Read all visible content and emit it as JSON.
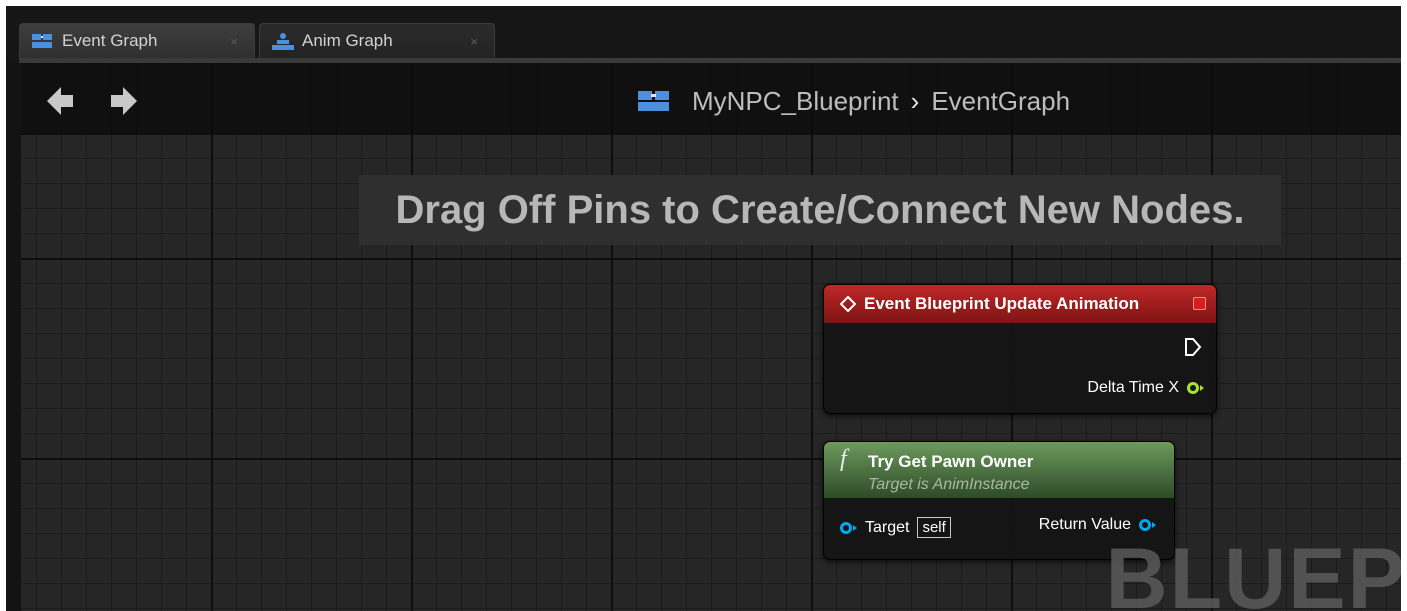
{
  "tabs": [
    {
      "label": "Event Graph",
      "close": "×",
      "icon": "event-graph-icon",
      "active": true
    },
    {
      "label": "Anim Graph",
      "close": "×",
      "icon": "anim-graph-icon",
      "active": false
    }
  ],
  "navigation": {
    "back_icon": "back-arrow-icon",
    "forward_icon": "forward-arrow-icon"
  },
  "breadcrumb": {
    "icon": "blueprint-icon",
    "asset": "MyNPC_Blueprint",
    "separator": "›",
    "graph": "EventGraph"
  },
  "hint": "Drag Off Pins to Create/Connect New Nodes.",
  "watermark": "BLUEP",
  "nodes": {
    "event": {
      "title": "Event Blueprint Update Animation",
      "pin_delta": "Delta Time X"
    },
    "pawn": {
      "func_symbol": "f",
      "title": "Try Get Pawn Owner",
      "subtitle": "Target is AnimInstance",
      "pin_target": "Target",
      "target_default": "self",
      "pin_return": "Return Value"
    }
  },
  "colors": {
    "event_header": "#c02828",
    "function_header": "#6d9a5d",
    "float_pin": "#a6e22e",
    "object_pin": "#00a8f0"
  }
}
